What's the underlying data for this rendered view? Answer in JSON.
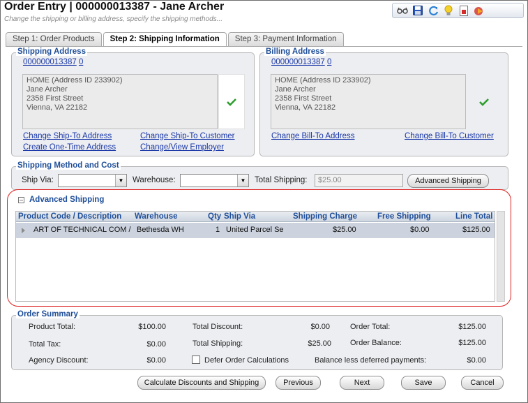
{
  "header": {
    "title": "Order Entry | 000000013387 - Jane Archer",
    "subtitle": "Change the shipping or billing address, specify the shipping methods..."
  },
  "toolbar": {
    "icons": [
      "glasses-icon",
      "save-icon",
      "refresh-icon",
      "lightbulb-icon",
      "report-icon",
      "exit-icon"
    ]
  },
  "tabs": [
    {
      "label": "Step 1: Order Products",
      "active": false
    },
    {
      "label": "Step 2: Shipping Information",
      "active": true
    },
    {
      "label": "Step 3: Payment Information",
      "active": false
    }
  ],
  "shipping_address": {
    "legend": "Shipping Address",
    "customer_id": "000000013387",
    "index": "0",
    "lines": [
      "HOME (Address ID 233902)",
      "Jane Archer",
      "2358 First Street",
      "Vienna, VA 22182"
    ],
    "links": {
      "change_ship_to_address": "Change Ship-To Address",
      "create_one_time_address": "Create One-Time Address",
      "change_ship_to_customer": "Change Ship-To Customer",
      "change_view_employer": "Change/View Employer"
    }
  },
  "billing_address": {
    "legend": "Billing Address",
    "customer_id": "000000013387",
    "index": "0",
    "lines": [
      "HOME (Address ID 233902)",
      "Jane Archer",
      "2358 First Street",
      "Vienna, VA 22182"
    ],
    "links": {
      "change_bill_to_address": "Change Bill-To Address",
      "change_bill_to_customer": "Change Bill-To Customer"
    }
  },
  "shipping_method": {
    "legend": "Shipping Method and Cost",
    "ship_via_label": "Ship Via:",
    "ship_via_value": "",
    "warehouse_label": "Warehouse:",
    "warehouse_value": "",
    "total_shipping_label": "Total Shipping:",
    "total_shipping_value": "$25.00",
    "advanced_button": "Advanced Shipping"
  },
  "advanced_shipping": {
    "title": "Advanced Shipping",
    "collapse_glyph": "–",
    "columns": {
      "product": "Product Code / Description",
      "warehouse": "Warehouse",
      "qty": "Qty",
      "ship_via": "Ship Via",
      "shipping_charge": "Shipping Charge",
      "free_shipping": "Free Shipping",
      "line_total": "Line Total"
    },
    "rows": [
      {
        "product": "ART OF TECHNICAL COM /",
        "warehouse": "Bethesda WH",
        "qty": "1",
        "ship_via": "United Parcel Se",
        "shipping_charge": "$25.00",
        "free_shipping": "$0.00",
        "line_total": "$125.00"
      }
    ]
  },
  "order_summary": {
    "legend": "Order Summary",
    "product_total_label": "Product Total:",
    "product_total": "$100.00",
    "total_tax_label": "Total Tax:",
    "total_tax": "$0.00",
    "agency_discount_label": "Agency Discount:",
    "agency_discount": "$0.00",
    "total_discount_label": "Total Discount:",
    "total_discount": "$0.00",
    "total_shipping_label": "Total Shipping:",
    "total_shipping": "$25.00",
    "defer_label": "Defer Order Calculations",
    "order_total_label": "Order Total:",
    "order_total": "$125.00",
    "order_balance_label": "Order Balance:",
    "order_balance": "$125.00",
    "balance_less_label": "Balance less deferred payments:",
    "balance_less": "$0.00"
  },
  "buttons": {
    "calculate": "Calculate Discounts and Shipping",
    "previous": "Previous",
    "next": "Next",
    "save": "Save",
    "cancel": "Cancel"
  },
  "colors": {
    "accent": "#1f4e99",
    "link": "#1a37a8",
    "highlight_ring": "#e02020",
    "check": "#2e9e2e"
  }
}
